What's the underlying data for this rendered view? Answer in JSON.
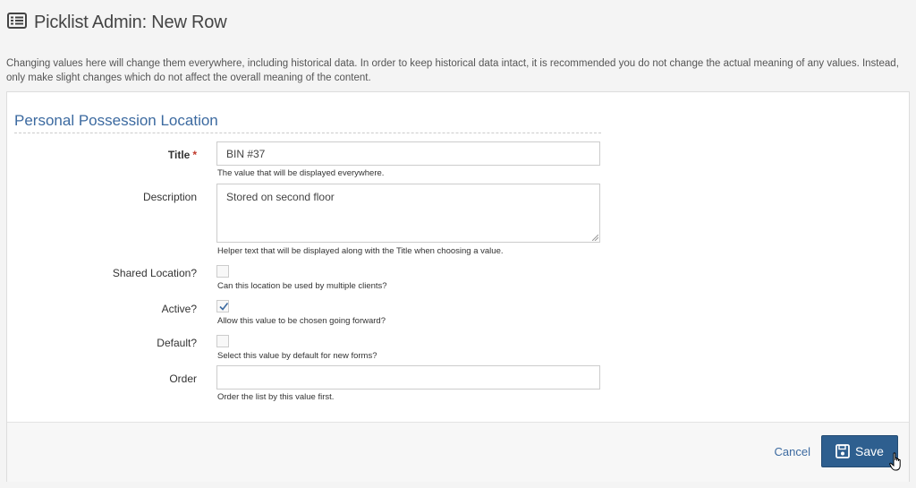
{
  "header": {
    "title": "Picklist Admin: New Row",
    "icon": "list-icon"
  },
  "intro": "Changing values here will change them everywhere, including historical data. In order to keep historical data intact, it is recommended you do not change the actual meaning of any values. Instead, only make slight changes which do not affect the overall meaning of the content.",
  "form": {
    "section_title": "Personal Possession Location",
    "title": {
      "label": "Title",
      "required_mark": "*",
      "value": "BIN #37",
      "help": "The value that will be displayed everywhere."
    },
    "description": {
      "label": "Description",
      "value": "Stored on second floor",
      "help": "Helper text that will be displayed along with the Title when choosing a value."
    },
    "shared_location": {
      "label": "Shared Location?",
      "checked": false,
      "help": "Can this location be used by multiple clients?"
    },
    "active": {
      "label": "Active?",
      "checked": true,
      "help": "Allow this value to be chosen going forward?"
    },
    "default": {
      "label": "Default?",
      "checked": false,
      "help": "Select this value by default for new forms?"
    },
    "order": {
      "label": "Order",
      "value": "",
      "help": "Order the list by this value first."
    }
  },
  "footer": {
    "cancel_label": "Cancel",
    "save_label": "Save",
    "save_icon": "floppy-disk-icon"
  },
  "colors": {
    "accent": "#3c6aa0",
    "primary_button": "#2e5f8f",
    "required": "#c0392b"
  }
}
